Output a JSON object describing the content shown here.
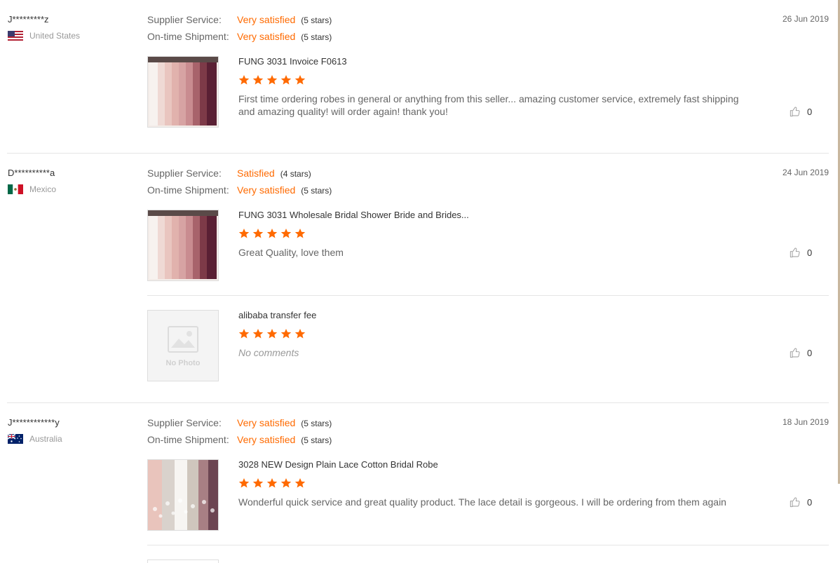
{
  "labels": {
    "supplier_service": "Supplier Service:",
    "ontime_shipment": "On-time Shipment:"
  },
  "accent_color": "#ff6a00",
  "reviews": [
    {
      "buyer": "J*********z",
      "country": "United States",
      "flag": "us-flag",
      "date": "26 Jun 2019",
      "supplier_service": {
        "value": "Very satisfied",
        "stars_text": "(5 stars)"
      },
      "ontime_shipment": {
        "value": "Very satisfied",
        "stars_text": "(5 stars)"
      },
      "items": [
        {
          "product": "FUNG 3031 Invoice F0613",
          "rating": 5,
          "comment": "First time ordering robes in general or anything from this seller... amazing customer service, extremely fast shipping and amazing quality! will order again! thank you!",
          "likes": "0",
          "image": "pink-robes-photo"
        }
      ]
    },
    {
      "buyer": "D**********a",
      "country": "Mexico",
      "flag": "mexico-flag",
      "date": "24 Jun 2019",
      "supplier_service": {
        "value": "Satisfied",
        "stars_text": "(4 stars)"
      },
      "ontime_shipment": {
        "value": "Very satisfied",
        "stars_text": "(5 stars)"
      },
      "items": [
        {
          "product": "FUNG 3031 Wholesale Bridal Shower Bride and Brides...",
          "rating": 5,
          "comment": "Great Quality, love them",
          "likes": "0",
          "image": "pink-robes-photo"
        },
        {
          "product": "alibaba transfer fee",
          "rating": 5,
          "comment": "No comments",
          "likes": "0",
          "image": "no-photo",
          "no_photo_text": "No Photo"
        }
      ]
    },
    {
      "buyer": "J************y",
      "country": "Australia",
      "flag": "australia-flag",
      "date": "18 Jun 2019",
      "supplier_service": {
        "value": "Very satisfied",
        "stars_text": "(5 stars)"
      },
      "ontime_shipment": {
        "value": "Very satisfied",
        "stars_text": "(5 stars)"
      },
      "items": [
        {
          "product": "3028 NEW Design Plain Lace Cotton Bridal Robe",
          "rating": 5,
          "comment": "Wonderful quick service and great quality product. The lace detail is gorgeous. I will be ordering from them again",
          "likes": "0",
          "image": "lace-robes-photo"
        }
      ]
    }
  ]
}
